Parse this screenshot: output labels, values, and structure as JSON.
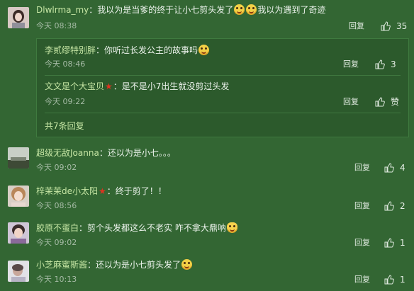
{
  "comments": [
    {
      "user": "Dlwlrma_my",
      "text_a": "我以为是当爹的终于让小七剪头发了",
      "text_b": "我以为遇到了奇迹",
      "time": "今天 08:38",
      "reply": "回复",
      "likes": "35",
      "replies": [
        {
          "user": "李贰缪特别胖",
          "text": "你听过长发公主的故事吗",
          "time": "今天 08:46",
          "reply": "回复",
          "likes": "3"
        },
        {
          "user": "文文是个大宝贝",
          "text": "是不是小7出生就没剪过头发",
          "time": "今天 09:22",
          "reply": "回复",
          "likes": "赞"
        }
      ],
      "more": "共7条回复"
    },
    {
      "user": "超级无敌Joanna",
      "text": "还以为是小七。。。",
      "time": "今天 09:02",
      "reply": "回复",
      "likes": "4"
    },
    {
      "user": "梓茉茉de小太阳",
      "text": "终于剪了！！",
      "time": "今天 08:56",
      "reply": "回复",
      "likes": "2"
    },
    {
      "user": "胶原不蛋白",
      "text": "剪个头发都这么不老实 咋不拿大鼎呐",
      "time": "今天 09:02",
      "reply": "回复",
      "likes": "1"
    },
    {
      "user": "小芝麻蜜斯酱",
      "text": "还以为是小七剪头发了",
      "time": "今天 10:13",
      "reply": "回复",
      "likes": "1"
    }
  ],
  "colon": "：",
  "icons": {
    "like": "thumbs-up-icon",
    "laugh": "laughing-tears-emoji",
    "cat": "cat-face-emoji",
    "star": "red-star-badge-icon"
  },
  "colors": {
    "background": "#336633",
    "username": "#c6e6a4",
    "subbox": "#2c5a2c",
    "star": "#e0321f"
  }
}
